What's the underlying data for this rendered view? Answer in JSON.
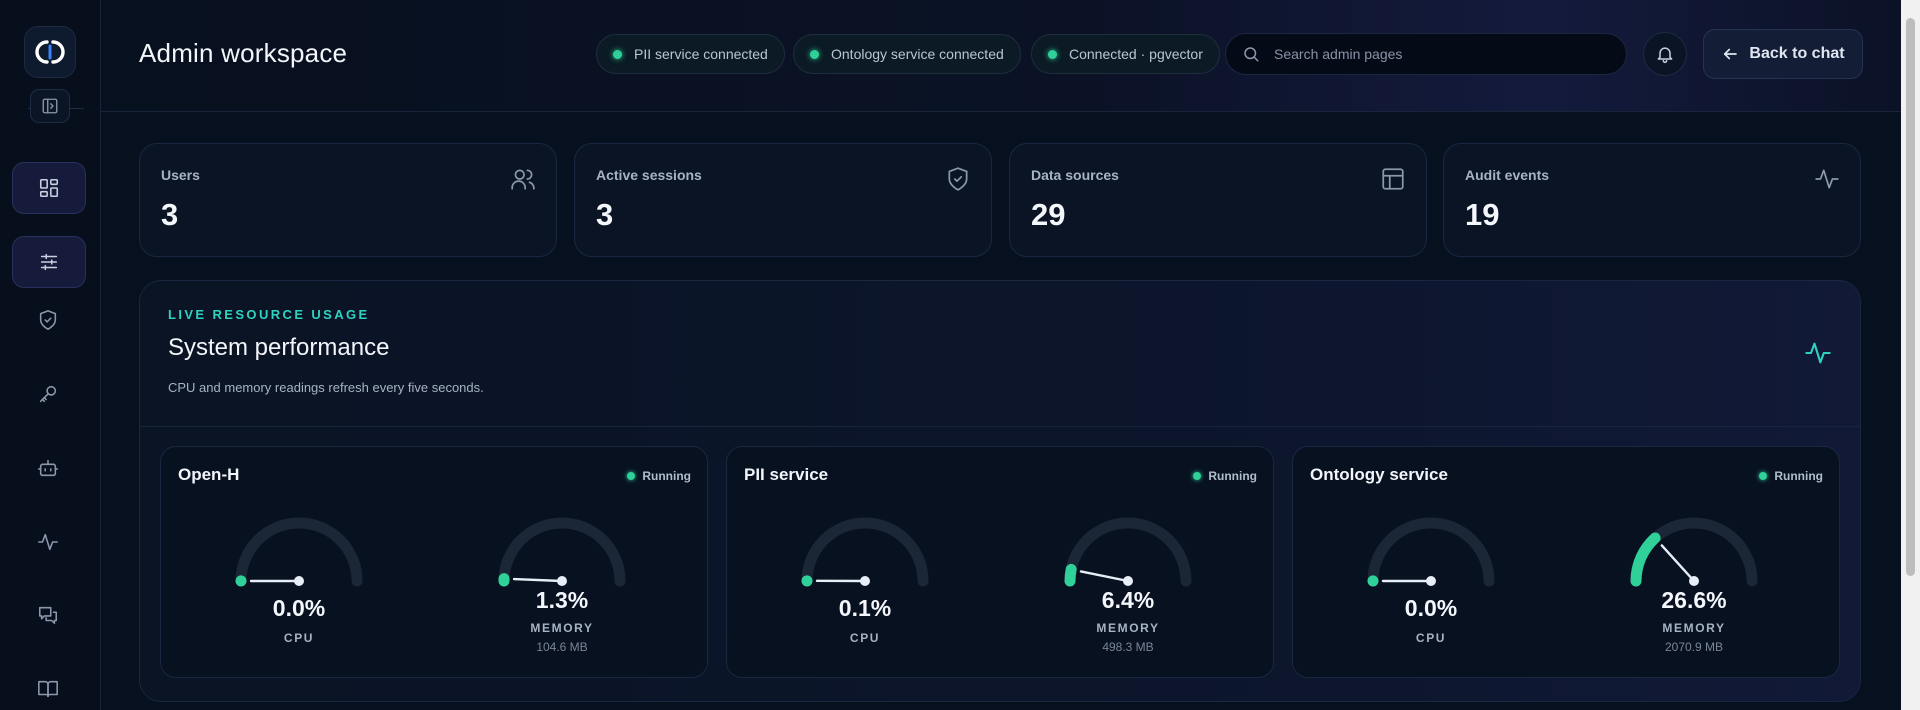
{
  "header": {
    "title": "Admin workspace",
    "status_pills": [
      {
        "label": "PII service connected"
      },
      {
        "label": "Ontology service connected"
      },
      {
        "label": "Connected · pgvector"
      }
    ],
    "search": {
      "placeholder": "Search admin pages",
      "value": ""
    },
    "back_button": "Back to chat"
  },
  "sidebar": {
    "items": [
      {
        "icon": "dashboard-icon",
        "active": true
      },
      {
        "icon": "sliders-icon",
        "active": true
      },
      {
        "icon": "shield-icon",
        "active": false
      },
      {
        "icon": "key-icon",
        "active": false
      },
      {
        "icon": "bot-icon",
        "active": false
      },
      {
        "icon": "activity-icon",
        "active": false
      },
      {
        "icon": "messages-icon",
        "active": false
      },
      {
        "icon": "book-icon",
        "active": false
      }
    ]
  },
  "stats": [
    {
      "label": "Users",
      "value": "3",
      "icon": "users-icon"
    },
    {
      "label": "Active sessions",
      "value": "3",
      "icon": "shield-check-icon"
    },
    {
      "label": "Data sources",
      "value": "29",
      "icon": "table-icon"
    },
    {
      "label": "Audit events",
      "value": "19",
      "icon": "activity-icon"
    }
  ],
  "performance": {
    "eyebrow": "LIVE RESOURCE USAGE",
    "title": "System performance",
    "description": "CPU and memory readings refresh every five seconds.",
    "services": [
      {
        "name": "Open-H",
        "status": "Running",
        "cpu": {
          "value": "0.0%",
          "fraction": 0.0,
          "label": "CPU"
        },
        "memory": {
          "value": "1.3%",
          "fraction": 0.013,
          "label": "MEMORY",
          "sub": "104.6 MB"
        }
      },
      {
        "name": "PII service",
        "status": "Running",
        "cpu": {
          "value": "0.1%",
          "fraction": 0.001,
          "label": "CPU"
        },
        "memory": {
          "value": "6.4%",
          "fraction": 0.064,
          "label": "MEMORY",
          "sub": "498.3 MB"
        }
      },
      {
        "name": "Ontology service",
        "status": "Running",
        "cpu": {
          "value": "0.0%",
          "fraction": 0.0,
          "label": "CPU"
        },
        "memory": {
          "value": "26.6%",
          "fraction": 0.266,
          "label": "MEMORY",
          "sub": "2070.9 MB"
        }
      }
    ]
  },
  "colors": {
    "accent": "#2fd198",
    "teal": "#2ed3c0",
    "track": "#1b2736",
    "background": "#07101e"
  }
}
